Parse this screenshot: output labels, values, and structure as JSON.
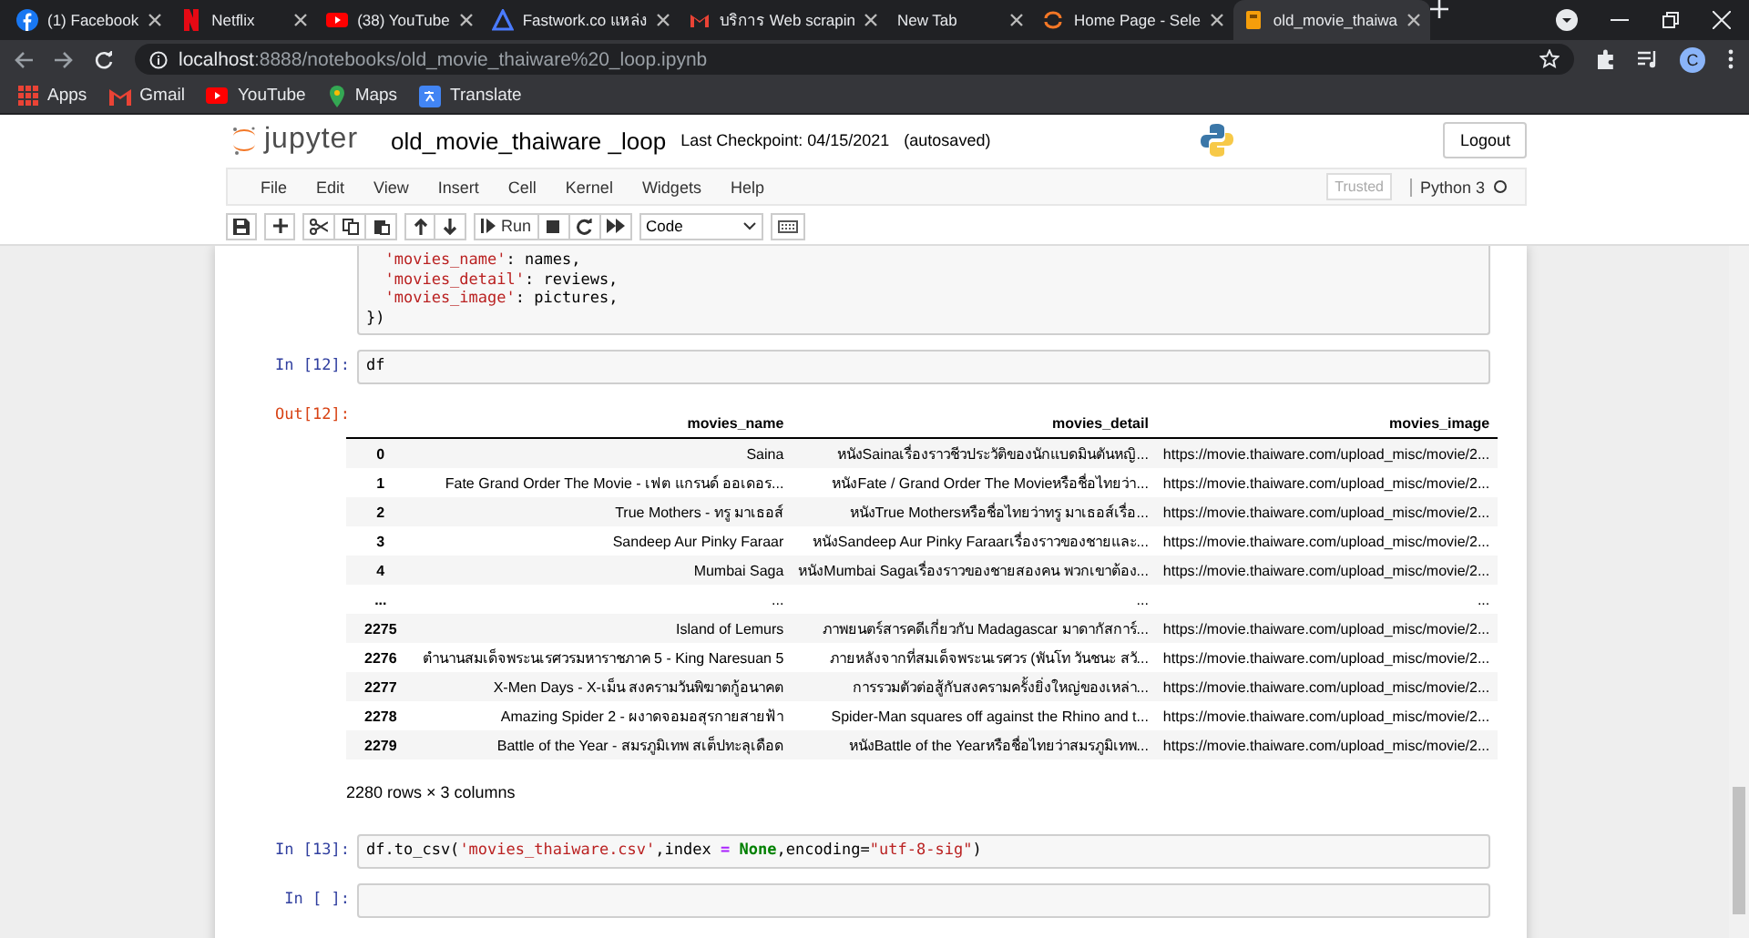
{
  "browser": {
    "tabs": [
      {
        "title": "(1) Facebook",
        "selected": false
      },
      {
        "title": "Netflix",
        "selected": false
      },
      {
        "title": "(38) YouTube",
        "selected": false
      },
      {
        "title": "Fastwork.co แหล่ง",
        "selected": false
      },
      {
        "title": "บริการ Web scrapin",
        "selected": false
      },
      {
        "title": "New Tab",
        "selected": false
      },
      {
        "title": "Home Page - Sele",
        "selected": false
      },
      {
        "title": "old_movie_thaiwa",
        "selected": true
      }
    ],
    "address": {
      "host": "localhost",
      "path": ":8888/notebooks/old_movie_thaiware%20_loop.ipynb"
    },
    "profile": "C",
    "bookmarks": [
      {
        "label": "Apps"
      },
      {
        "label": "Gmail"
      },
      {
        "label": "YouTube"
      },
      {
        "label": "Maps"
      },
      {
        "label": "Translate"
      }
    ]
  },
  "header": {
    "logo": "jupyter",
    "notebook_name": "old_movie_thaiware _loop",
    "checkpoint": "Last Checkpoint: 04/15/2021",
    "save_status": "(autosaved)",
    "logout": "Logout"
  },
  "menu": [
    "File",
    "Edit",
    "View",
    "Insert",
    "Cell",
    "Kernel",
    "Widgets",
    "Help"
  ],
  "trusted": "Trusted",
  "kernel": {
    "name": "Python 3",
    "busy": false
  },
  "toolbar": {
    "run_label": "Run",
    "cell_type": "Code"
  },
  "cells": [
    {
      "lines": [
        {
          "indent": true,
          "tokens": [
            {
              "kind": "string",
              "text": "'movies_name'"
            },
            {
              "kind": "plain",
              "text": ": names,"
            }
          ]
        },
        {
          "indent": true,
          "tokens": [
            {
              "kind": "string",
              "text": "'movies_detail'"
            },
            {
              "kind": "plain",
              "text": ": reviews,"
            }
          ]
        },
        {
          "indent": true,
          "tokens": [
            {
              "kind": "string",
              "text": "'movies_image'"
            },
            {
              "kind": "plain",
              "text": ": pictures,"
            }
          ]
        },
        {
          "indent": false,
          "tokens": [
            {
              "kind": "plain",
              "text": "})"
            }
          ]
        }
      ]
    },
    {
      "prompt": "In [12]:",
      "lines": [
        {
          "indent": false,
          "tokens": [
            {
              "kind": "plain",
              "text": "df"
            }
          ]
        }
      ],
      "output": {
        "prompt": "Out[12]:",
        "columns": [
          "",
          "movies_name",
          "movies_detail",
          "movies_image"
        ],
        "rows": [
          [
            "0",
            "Saina",
            "หนังSainaเรื่องราวชีวประวัติของนักแบดมินตันหญิ...",
            "https://movie.thaiware.com/upload_misc/movie/2..."
          ],
          [
            "1",
            "Fate Grand Order The Movie - เฟต แกรนด์ ออเดอร...",
            "หนังFate / Grand Order The Movieหรือชื่อไทยว่า...",
            "https://movie.thaiware.com/upload_misc/movie/2..."
          ],
          [
            "2",
            "True Mothers - ทรู มาเธอส์",
            "หนังTrue Mothersหรือชื่อไทยว่าทรู มาเธอส์เรื่อ...",
            "https://movie.thaiware.com/upload_misc/movie/2..."
          ],
          [
            "3",
            "Sandeep Aur Pinky Faraar",
            "หนังSandeep Aur Pinky Faraarเรื่องราวของชายและ...",
            "https://movie.thaiware.com/upload_misc/movie/2..."
          ],
          [
            "4",
            "Mumbai Saga",
            "หนังMumbai Sagaเรื่องราวของชายสองคน พวกเขาต้อง...",
            "https://movie.thaiware.com/upload_misc/movie/2..."
          ],
          [
            "...",
            "...",
            "...",
            "..."
          ],
          [
            "2275",
            "Island of Lemurs",
            "ภาพยนตร์สารคดีเกี่ยวกับ Madagascar มาดากัสการ์...",
            "https://movie.thaiware.com/upload_misc/movie/2..."
          ],
          [
            "2276",
            "ตำนานสมเด็จพระนเรศวรมหาราชภาค 5 - King Naresuan 5",
            "ภายหลังจากที่สมเด็จพระนเรศวร (พันโท วันชนะ สวั...",
            "https://movie.thaiware.com/upload_misc/movie/2..."
          ],
          [
            "2277",
            "X-Men Days - X-เม็น สงครามวันพิฆาตกู้อนาคต",
            "การรวมตัวต่อสู้กับสงครามครั้งยิ่งใหญ่ของเหล่า...",
            "https://movie.thaiware.com/upload_misc/movie/2..."
          ],
          [
            "2278",
            "Amazing Spider 2 - ผงาดจอมอสุรกายสายฟ้า",
            "Spider-Man squares off against the Rhino and t...",
            "https://movie.thaiware.com/upload_misc/movie/2..."
          ],
          [
            "2279",
            "Battle of the Year - สมรภูมิเทพ สเต็ปทะลุเดือด",
            "หนังBattle of the Yearหรือชื่อไทยว่าสมรภูมิเทพ...",
            "https://movie.thaiware.com/upload_misc/movie/2..."
          ]
        ],
        "shape": "2280 rows × 3 columns"
      }
    },
    {
      "prompt": "In [13]:",
      "lines": [
        {
          "indent": false,
          "tokens": [
            {
              "kind": "plain",
              "text": "df.to_csv("
            },
            {
              "kind": "string",
              "text": "'movies_thaiware.csv'"
            },
            {
              "kind": "plain",
              "text": ",index "
            },
            {
              "kind": "operator",
              "text": "= "
            },
            {
              "kind": "keyword",
              "text": "None"
            },
            {
              "kind": "plain",
              "text": ",encoding="
            },
            {
              "kind": "string",
              "text": "\"utf-8-sig\""
            },
            {
              "kind": "plain",
              "text": ")"
            }
          ]
        }
      ]
    },
    {
      "prompt": "In [ ]:"
    }
  ]
}
